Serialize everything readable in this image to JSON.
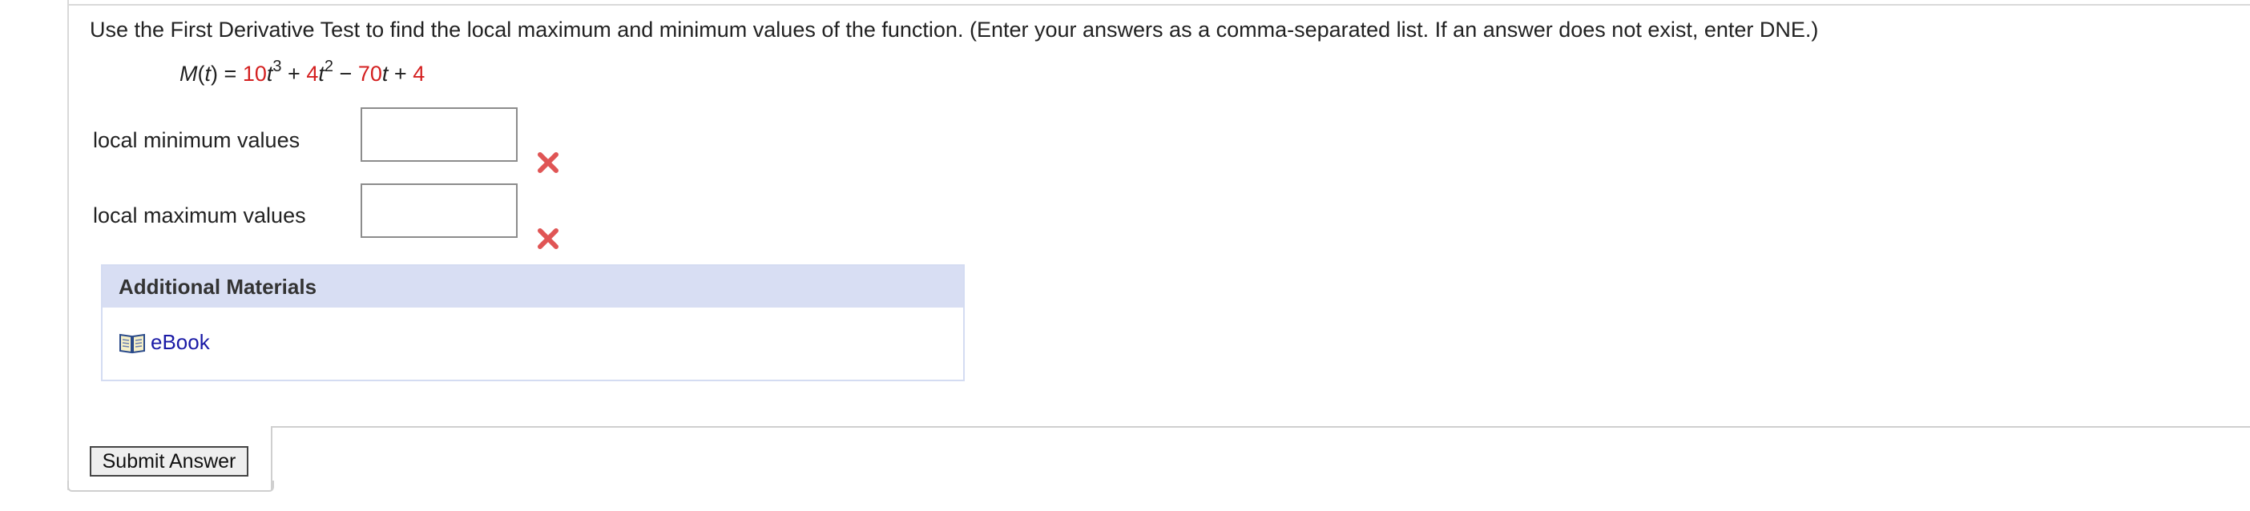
{
  "question": {
    "text": "Use the First Derivative Test to find the local maximum and minimum values of the function. (Enter your answers as a comma-separated list. If an answer does not exist, enter DNE.)"
  },
  "equation": {
    "func": "M",
    "var": "t",
    "open_paren": "(",
    "close_paren": ")",
    "equals": "=",
    "coef1": "10",
    "exp1": "3",
    "plus1": "+",
    "coef2": "4",
    "exp2": "2",
    "minus": "−",
    "coef3": "70",
    "plus2": "+",
    "const": "4"
  },
  "answers": {
    "min_label": "local minimum values",
    "min_value": "",
    "max_label": "local maximum values",
    "max_value": ""
  },
  "status_icons": {
    "min": "incorrect-x-icon",
    "max": "incorrect-x-icon",
    "color": "#e05555"
  },
  "materials": {
    "header": "Additional Materials",
    "ebook_label": "eBook",
    "ebook_icon": "book-icon"
  },
  "submit": {
    "label": "Submit Answer"
  },
  "colors": {
    "coefficient": "#d42020",
    "link": "#1a1aa6",
    "materials_header_bg": "#d8def3"
  }
}
